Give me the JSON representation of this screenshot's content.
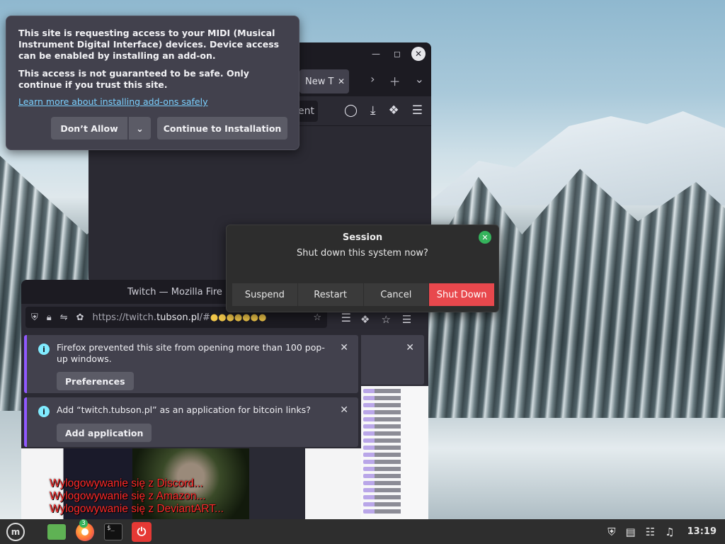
{
  "midi_prompt": {
    "message": "This site is requesting access to your MIDI (Musical Instrument Digital Interface) devices. Device access can be enabled by installing an add-on.",
    "warning": "This access is not guaranteed to be safe. Only continue if you trust this site.",
    "link": "Learn more about installing add-ons safely",
    "dont_allow": "Don’t Allow",
    "continue": "Continue to Installation"
  },
  "back_window": {
    "tab_label": "New T",
    "url_fragment": "ent"
  },
  "session": {
    "title": "Session",
    "question": "Shut down this system now?",
    "buttons": [
      "Suspend",
      "Restart",
      "Cancel",
      "Shut Down"
    ]
  },
  "twitch_window": {
    "title": "Twitch — Mozilla Fire",
    "url_prefix": "https://twitch.",
    "url_host": "tubson.pl",
    "url_suffix": "/#",
    "notif_popups": {
      "message": "Firefox prevented this site from opening more than 100 pop-up windows.",
      "button": "Preferences"
    },
    "notif_handler": {
      "message": "Add “twitch.tubson.pl” as an application for bitcoin links?",
      "button": "Add application"
    }
  },
  "logout_lines": [
    "Wylogowywanie się z Discord...",
    "Wylogowywanie się z Amazon...",
    "Wylogowywanie się z DeviantART..."
  ],
  "taskbar": {
    "menu_label": "m",
    "firefox_badge": "3",
    "terminal_glyph": "$_",
    "clock": "13:19"
  },
  "colors": {
    "accent_purple": "#9059ff",
    "shutdown_red": "#e8484d",
    "link_blue": "#7ad0ff"
  }
}
